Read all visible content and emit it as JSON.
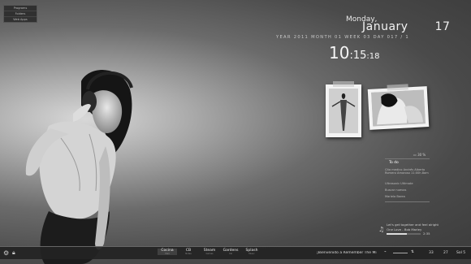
{
  "menu": {
    "items": [
      "Programs",
      "Folders",
      "Web Apps"
    ]
  },
  "datetime": {
    "weekday": "Monday,",
    "month": "January",
    "day": "17",
    "info": "YEAR 2011   MONTH 01   WEEK 03   DAY 017 / 1",
    "hour": "10",
    "minute": ":15",
    "second": ":18"
  },
  "weather": {
    "temp": "30 %"
  },
  "todo": {
    "title": "To do",
    "items": [
      "Cita medico Andrés Alberto Romero Amoroso 11:00h.8am",
      "Ultrasonic Ultimate",
      "Buscar nuevos",
      "Mariela Barea"
    ]
  },
  "music": {
    "line1": "Let's get together and feel alright",
    "line2": "One Love - Bob Marley",
    "time": "2:35"
  },
  "taskbar": {
    "tabs": [
      {
        "label": "Cocina",
        "sub": "Mail"
      },
      {
        "label": "CB",
        "sub": "Notes"
      },
      {
        "label": "Steam",
        "sub": "Games"
      },
      {
        "label": "Gardens",
        "sub": "Cal"
      },
      {
        "label": "Splash",
        "sub": "Music"
      }
    ],
    "now_playing": "¡Bienvenido a Remember The Mi",
    "tray": [
      "33",
      "27",
      "Sol 5"
    ]
  },
  "colors": {
    "taskbar": "#232323",
    "text": "#dddddd",
    "accent": "#f2f2f2"
  }
}
